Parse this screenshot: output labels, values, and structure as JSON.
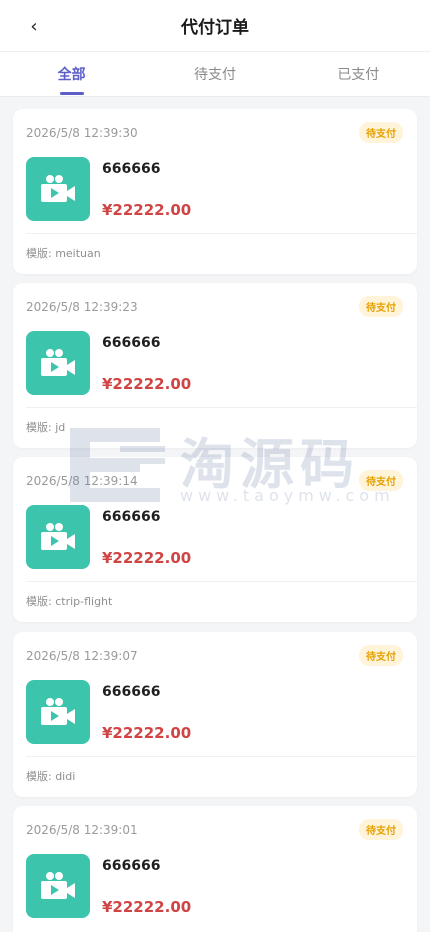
{
  "header": {
    "title": "代付订单",
    "back_icon": "‹"
  },
  "tabs": [
    {
      "label": "全部",
      "active": true
    },
    {
      "label": "待支付",
      "active": false
    },
    {
      "label": "已支付",
      "active": false
    }
  ],
  "orders": [
    {
      "time": "2026/5/8 12:39:30",
      "status": "待支付",
      "name": "666666",
      "price": "¥22222.00",
      "template": "模版: meituan"
    },
    {
      "time": "2026/5/8 12:39:23",
      "status": "待支付",
      "name": "666666",
      "price": "¥22222.00",
      "template": "模版: jd"
    },
    {
      "time": "2026/5/8 12:39:14",
      "status": "待支付",
      "name": "666666",
      "price": "¥22222.00",
      "template": "模版: ctrip-flight"
    },
    {
      "time": "2026/5/8 12:39:07",
      "status": "待支付",
      "name": "666666",
      "price": "¥22222.00",
      "template": "模版: didi"
    },
    {
      "time": "2026/5/8 12:39:01",
      "status": "待支付",
      "name": "666666",
      "price": "¥22222.00",
      "template": ""
    }
  ],
  "watermark": {
    "text": "淘源码",
    "url": "www.taoymw.com"
  },
  "colors": {
    "accent": "#5b5fc7",
    "thumb": "#3cc4ad",
    "price": "#d04444",
    "status_bg": "#fff3da",
    "status_text": "#e6a100"
  }
}
